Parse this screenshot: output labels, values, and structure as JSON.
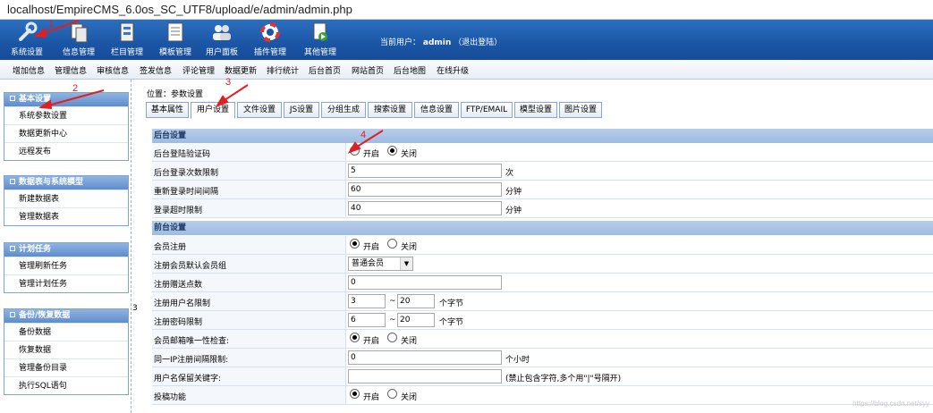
{
  "url": "localhost/EmpireCMS_6.0os_SC_UTF8/upload/e/admin/admin.php",
  "toolbar": [
    {
      "label": "系统设置",
      "icon": "wrench-icon"
    },
    {
      "label": "信息管理",
      "icon": "documents-icon"
    },
    {
      "label": "栏目管理",
      "icon": "column-icon"
    },
    {
      "label": "模板管理",
      "icon": "template-icon"
    },
    {
      "label": "用户面板",
      "icon": "users-icon"
    },
    {
      "label": "插件管理",
      "icon": "lifebuoy-icon"
    },
    {
      "label": "其他管理",
      "icon": "other-icon"
    }
  ],
  "current_user": {
    "prefix": "当前用户：",
    "name": "admin",
    "logout": "（退出登陆）"
  },
  "submenu": [
    "增加信息",
    "管理信息",
    "审核信息",
    "签发信息",
    "评论管理",
    "数据更新",
    "排行统计",
    "后台首页",
    "网站首页",
    "后台地图",
    "在线升级"
  ],
  "sidebar": [
    {
      "title": "基本设置",
      "items": [
        "系统参数设置",
        "数据更新中心",
        "远程发布"
      ]
    },
    {
      "title": "数据表与系统模型",
      "items": [
        "新建数据表",
        "管理数据表"
      ]
    },
    {
      "title": "计划任务",
      "items": [
        "管理刷新任务",
        "管理计划任务"
      ]
    },
    {
      "title": "备份/恢复数据",
      "items": [
        "备份数据",
        "恢复数据",
        "管理备份目录",
        "执行SQL语句"
      ]
    }
  ],
  "divider_text": "3",
  "breadcrumb": "位置：参数设置",
  "tabs": [
    "基本属性",
    "用户设置",
    "文件设置",
    "JS设置",
    "分组生成",
    "搜索设置",
    "信息设置",
    "FTP/EMAIL",
    "模型设置",
    "图片设置"
  ],
  "active_tab": "用户设置",
  "sections": {
    "backend": "后台设置",
    "frontend": "前台设置"
  },
  "backend_rows": {
    "captcha": {
      "label": "后台登陆验证码",
      "on": "开启",
      "off": "关闭",
      "selected": "off"
    },
    "login_count": {
      "label": "后台登录次数限制",
      "value": "5",
      "unit": "次"
    },
    "relogin": {
      "label": "重新登录时间间隔",
      "value": "60",
      "unit": "分钟"
    },
    "timeout": {
      "label": "登录超时限制",
      "value": "40",
      "unit": "分钟"
    }
  },
  "frontend_rows": {
    "register": {
      "label": "会员注册",
      "on": "开启",
      "off": "关闭",
      "selected": "on"
    },
    "default_group": {
      "label": "注册会员默认会员组",
      "value": "普通会员"
    },
    "points": {
      "label": "注册赠送点数",
      "value": "0"
    },
    "username_len": {
      "label": "注册用户名限制",
      "min": "3",
      "sep": "~",
      "max": "20",
      "unit": "个字节"
    },
    "password_len": {
      "label": "注册密码限制",
      "min": "6",
      "sep": "~",
      "max": "20",
      "unit": "个字节"
    },
    "email_unique": {
      "label": "会员邮箱唯一性检查:",
      "on": "开启",
      "off": "关闭",
      "selected": "on"
    },
    "ip_interval": {
      "label": "同一IP注册间隔限制:",
      "value": "0",
      "unit": "个小时"
    },
    "reserved": {
      "label": "用户名保留关键字:",
      "value": "",
      "note": "(禁止包含字符,多个用\"|\"号隔开)"
    },
    "submit": {
      "label": "投稿功能",
      "on": "开启",
      "off": "关闭",
      "selected": "on"
    }
  },
  "annotations": [
    "1",
    "2",
    "3",
    "4"
  ],
  "watermark": "https://blog.csdn.net/syy",
  "colors": {
    "topbar": "#1b56a6",
    "annotation": "#e02020",
    "section": "#a9c3e5"
  }
}
